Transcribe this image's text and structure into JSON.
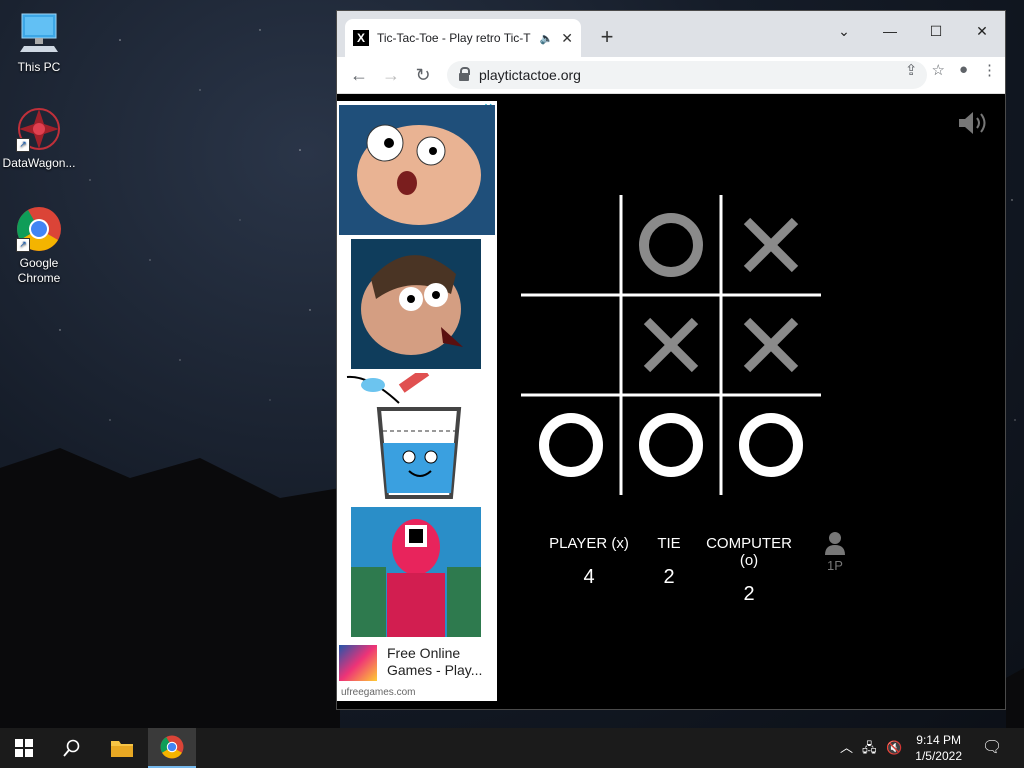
{
  "desktop": {
    "icons": [
      {
        "label": "This PC"
      },
      {
        "label": "DataWagon..."
      },
      {
        "label": "Google Chrome"
      }
    ]
  },
  "browser": {
    "tab_title": "Tic-Tac-Toe - Play retro Tic-T",
    "favicon": "X",
    "url": "playtictactoe.org"
  },
  "ads": {
    "close_label": "✕",
    "promo_title": "Free Online Games - Play...",
    "promo_domain": "ufreegames.com"
  },
  "game": {
    "board": [
      "",
      "O",
      "X",
      "",
      "X",
      "X",
      "O",
      "O",
      "O"
    ],
    "winning_cells": [
      6,
      7,
      8
    ],
    "scores": [
      {
        "label": "PLAYER (x)",
        "value": "4"
      },
      {
        "label": "TIE",
        "value": "2"
      },
      {
        "label": "COMPUTER (o)",
        "value": "2"
      }
    ],
    "mode": "1P"
  },
  "taskbar": {
    "time": "9:14 PM",
    "date": "1/5/2022"
  }
}
